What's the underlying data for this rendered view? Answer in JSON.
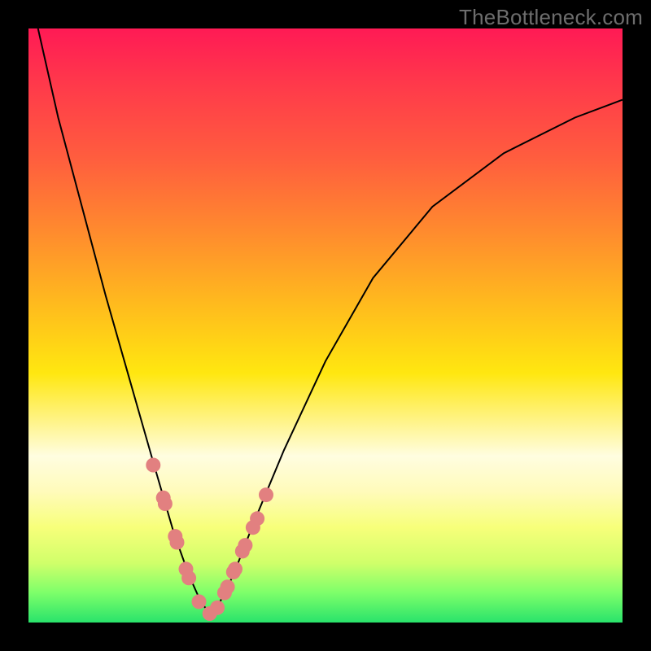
{
  "watermark": "TheBottleneck.com",
  "colors": {
    "frame_bg": "#000000",
    "curve": "#000000",
    "marker": "#e28080",
    "gradient_stops": [
      "#ff1a55",
      "#ff3b4a",
      "#ff5e3e",
      "#ff8a2e",
      "#ffb91e",
      "#ffe710",
      "#fffde0",
      "#fffbba",
      "#f7ff7a",
      "#d0ff6a",
      "#7dff6a",
      "#29e36b"
    ]
  },
  "chart_data": {
    "type": "line",
    "title": "",
    "xlabel": "",
    "ylabel": "",
    "xlim": [
      0,
      1
    ],
    "ylim": [
      0,
      1
    ],
    "note": "Axes are unlabeled in the source image. x/y are normalized plot-area coordinates (0–1), origin at top-left, so higher y = lower on screen. Curve is a V-shaped bottleneck profile with minimum near x≈0.30; markers cluster around the minimum on both arms.",
    "series": [
      {
        "name": "bottleneck-curve",
        "x": [
          0.016,
          0.05,
          0.09,
          0.13,
          0.17,
          0.21,
          0.245,
          0.27,
          0.29,
          0.305,
          0.32,
          0.345,
          0.38,
          0.43,
          0.5,
          0.58,
          0.68,
          0.8,
          0.92,
          1.0
        ],
        "y": [
          0.0,
          0.15,
          0.3,
          0.45,
          0.59,
          0.73,
          0.85,
          0.92,
          0.965,
          0.985,
          0.97,
          0.92,
          0.83,
          0.71,
          0.56,
          0.42,
          0.3,
          0.21,
          0.15,
          0.12
        ]
      }
    ],
    "markers": {
      "name": "highlighted-range",
      "x": [
        0.21,
        0.227,
        0.23,
        0.247,
        0.25,
        0.265,
        0.27,
        0.287,
        0.305,
        0.318,
        0.33,
        0.335,
        0.345,
        0.348,
        0.36,
        0.365,
        0.378,
        0.385,
        0.4
      ],
      "y": [
        0.735,
        0.79,
        0.8,
        0.855,
        0.865,
        0.91,
        0.925,
        0.965,
        0.985,
        0.975,
        0.95,
        0.94,
        0.915,
        0.91,
        0.88,
        0.87,
        0.84,
        0.825,
        0.785
      ]
    }
  }
}
